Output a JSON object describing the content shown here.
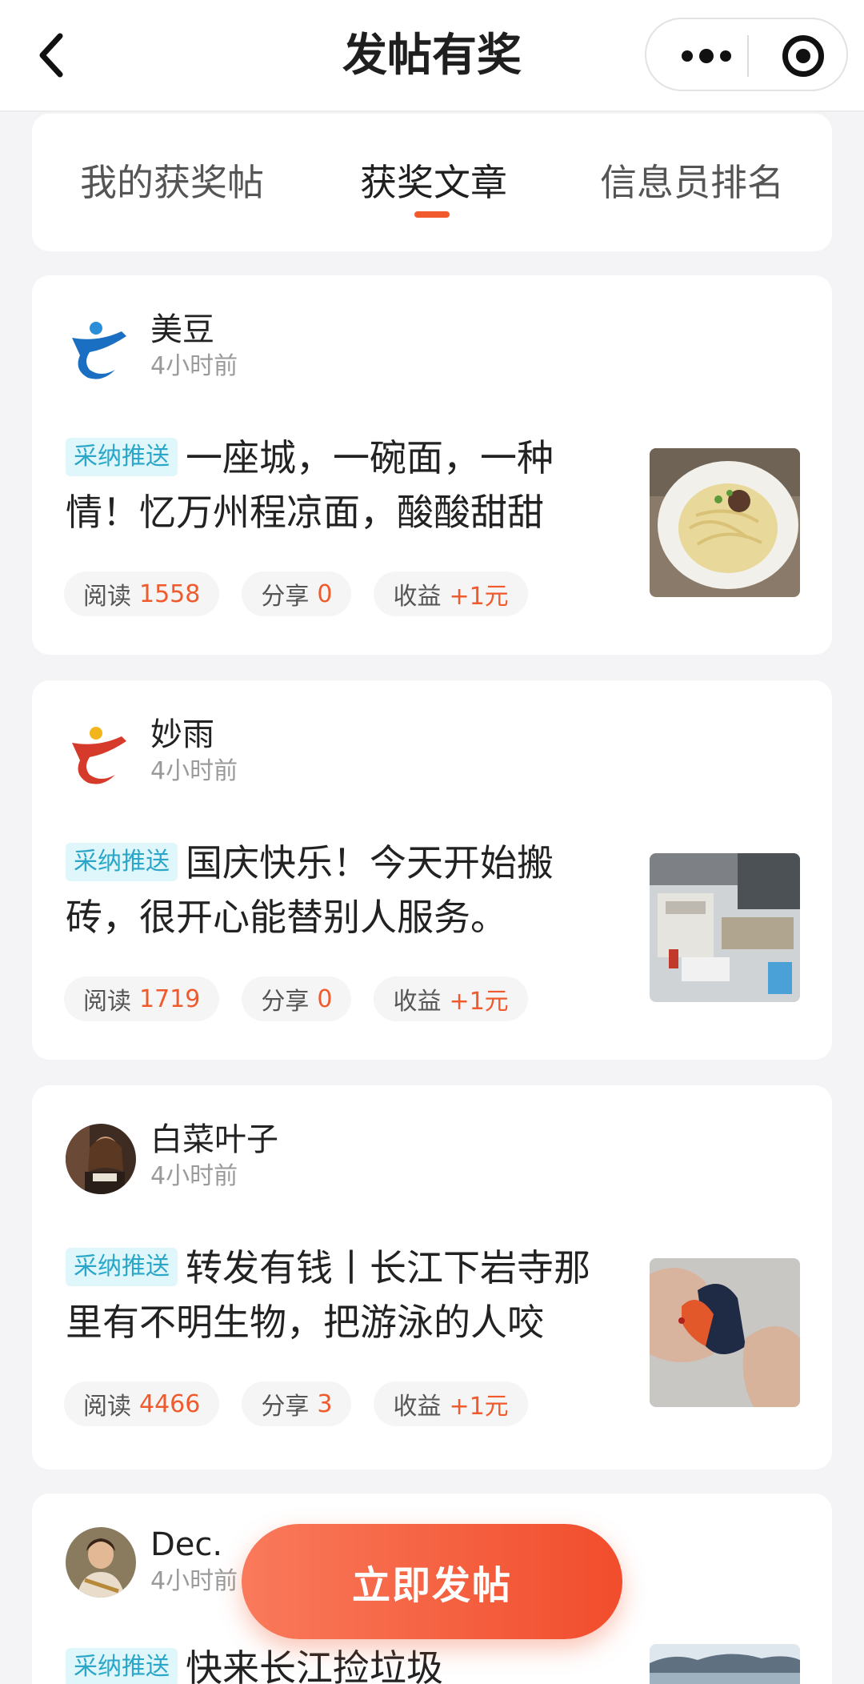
{
  "nav": {
    "title": "发帖有奖"
  },
  "tabs": [
    {
      "label": "我的获奖帖"
    },
    {
      "label": "获奖文章"
    },
    {
      "label": "信息员排名"
    }
  ],
  "posts": [
    {
      "author": "美豆",
      "time": "4小时前",
      "tag": "采纳推送",
      "title": "一座城，一碗面，一种情！忆万州程凉面，酸酸甜甜",
      "stats": [
        {
          "label": "阅读",
          "value": "1558"
        },
        {
          "label": "分享",
          "value": "0"
        },
        {
          "label": "收益",
          "value": "+1元"
        }
      ]
    },
    {
      "author": "妙雨",
      "time": "4小时前",
      "tag": "采纳推送",
      "title": "国庆快乐！今天开始搬砖，很开心能替别人服务。",
      "stats": [
        {
          "label": "阅读",
          "value": "1719"
        },
        {
          "label": "分享",
          "value": "0"
        },
        {
          "label": "收益",
          "value": "+1元"
        }
      ]
    },
    {
      "author": "白菜叶子",
      "time": "4小时前",
      "tag": "采纳推送",
      "title": "转发有钱丨长江下岩寺那里有不明生物，把游泳的人咬",
      "stats": [
        {
          "label": "阅读",
          "value": "4466"
        },
        {
          "label": "分享",
          "value": "3"
        },
        {
          "label": "收益",
          "value": "+1元"
        }
      ]
    },
    {
      "author": "Dec.",
      "time": "4小时前",
      "tag": "采纳推送",
      "title": "快来长江捡垃圾"
    }
  ],
  "fab": {
    "label": "立即发帖"
  },
  "colors": {
    "accent": "#f05a2c",
    "tag_text": "#2aa6c9",
    "tag_bg": "#dff6fa"
  }
}
